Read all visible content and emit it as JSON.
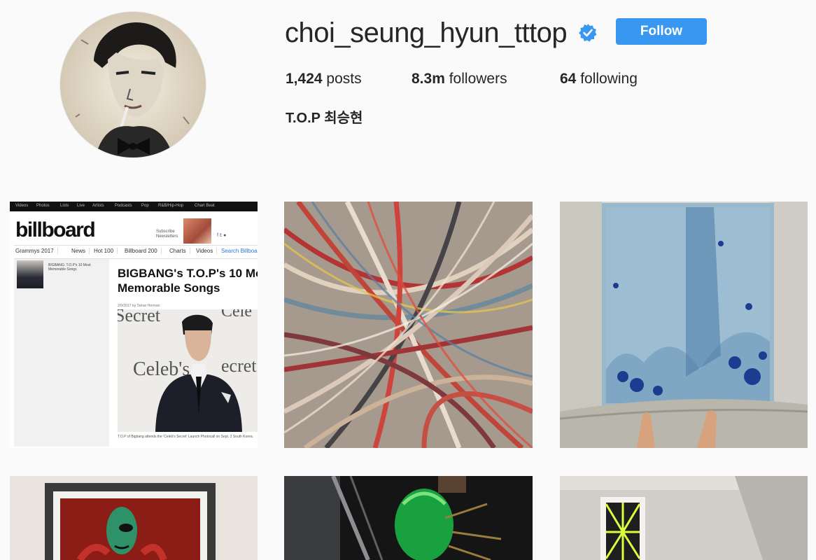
{
  "profile": {
    "username": "choi_seung_hyun_tttop",
    "verified": true,
    "follow_label": "Follow",
    "posts_count": "1,424",
    "posts_label": "posts",
    "followers_count": "8.3m",
    "followers_label": "followers",
    "following_count": "64",
    "following_label": "following",
    "full_name": "T.O.P 최승현"
  },
  "posts": [
    {
      "kind": "screenshot",
      "nav": [
        "Videos",
        "Photos",
        "Lists",
        "Live",
        "Artists",
        "Podcasts",
        "Pop",
        "R&B/Hip-Hop",
        "Chart Beat"
      ],
      "logo": "billboard",
      "subscribe": "Subscribe Newsletters",
      "tabs": [
        "Grammys 2017",
        "News",
        "Hot 100",
        "Billboard 200",
        "Charts",
        "Videos",
        "Search Billboard"
      ],
      "headline_line1": "BIGBANG's T.O.P's 10 Mo",
      "headline_line2": "Memorable Songs",
      "sidebar_text": "BIGBANG: T.O.P's 10 Most Memorable Songs",
      "date_line": "2/9/2017 by Tamar Herman",
      "photo_text_left": "Secret",
      "photo_text_right": "Cele",
      "photo_text_mid": "Celeb's",
      "photo_text_mid2": "ecret",
      "caption": "T.O.P of Bigbang attends the 'Celeb's Secret' Launch Photocall on Sept. 2 South Korea."
    },
    {
      "kind": "painting-streaks"
    },
    {
      "kind": "painting-blue"
    },
    {
      "kind": "painting-alien"
    },
    {
      "kind": "green-hair"
    },
    {
      "kind": "framed-burst"
    }
  ],
  "colors": {
    "follow_button": "#3897f0",
    "verified_badge": "#3897f0",
    "text": "#262626",
    "background": "#fafafa"
  }
}
